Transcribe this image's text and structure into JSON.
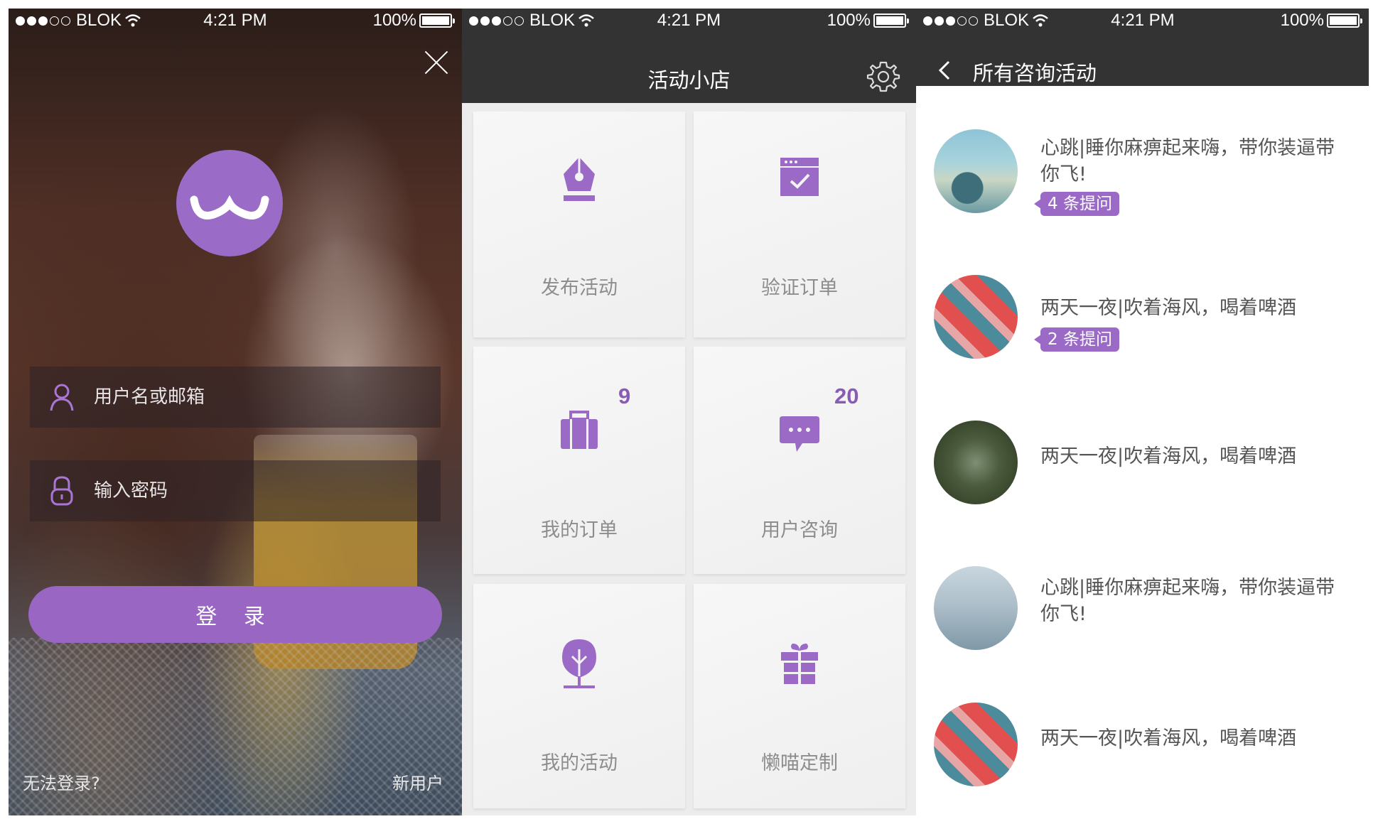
{
  "status_bar": {
    "carrier": "BLOK",
    "time": "4:21 PM",
    "battery": "100%"
  },
  "login_screen": {
    "username_placeholder": "用户名或邮箱",
    "password_placeholder": "输入密码",
    "login_button": "登 录",
    "forgot_link": "无法登录?",
    "new_user_link": "新用户"
  },
  "shop_screen": {
    "title": "活动小店",
    "tiles": [
      {
        "label": "发布活动",
        "icon": "pen-nib-icon",
        "badge": ""
      },
      {
        "label": "验证订单",
        "icon": "calendar-check-icon",
        "badge": ""
      },
      {
        "label": "我的订单",
        "icon": "briefcase-icon",
        "badge": "9"
      },
      {
        "label": "用户咨询",
        "icon": "chat-bubble-icon",
        "badge": "20"
      },
      {
        "label": "我的活动",
        "icon": "tree-icon",
        "badge": ""
      },
      {
        "label": "懒喵定制",
        "icon": "gift-icon",
        "badge": ""
      }
    ]
  },
  "consult_screen": {
    "title": "所有咨询活动",
    "items": [
      {
        "text": "心跳|睡你麻痹起来嗨，带你装逼带你飞!",
        "badge": "4 条提问"
      },
      {
        "text": "两天一夜|吹着海风，喝着啤酒",
        "badge": "2 条提问"
      },
      {
        "text": "两天一夜|吹着海风，喝着啤酒",
        "badge": ""
      },
      {
        "text": "心跳|睡你麻痹起来嗨，带你装逼带你飞!",
        "badge": ""
      },
      {
        "text": "两天一夜|吹着海风，喝着啤酒",
        "badge": ""
      }
    ]
  },
  "colors": {
    "accent": "#9966c4",
    "topbar": "#333333",
    "tile_label": "#8d8d8d"
  }
}
